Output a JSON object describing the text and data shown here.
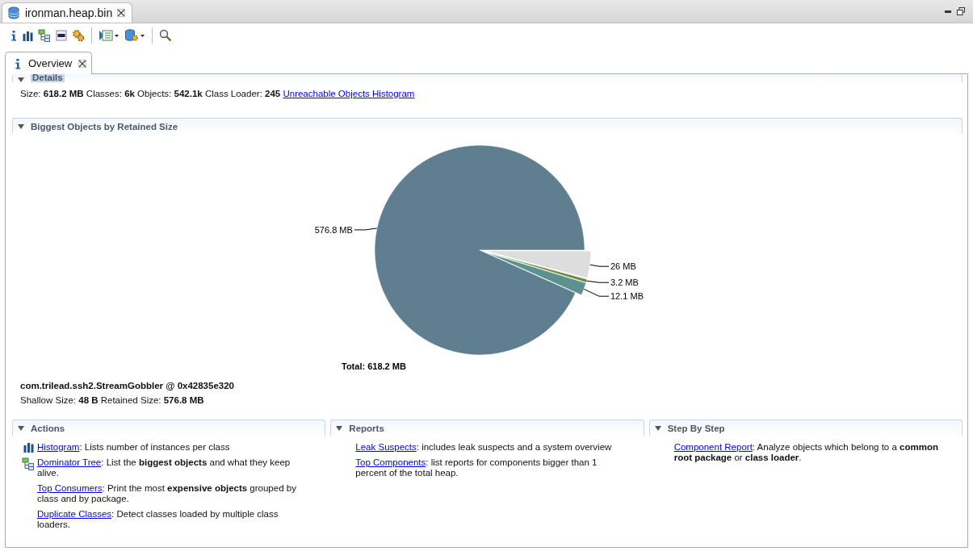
{
  "editor_tab": {
    "title": "ironman.heap.bin",
    "selected": true
  },
  "overview_tab": {
    "label": "Overview",
    "selected": true
  },
  "details": {
    "title": "Details",
    "expanded": true,
    "summary": "Size: **618.2 MB** Classes: **6k** Objects: **542.1k** Class Loader: **245**",
    "link": "Unreachable Objects Histogram"
  },
  "biggest_objects": {
    "title": "Biggest Objects by Retained Size",
    "expanded": true,
    "chart_data": {
      "type": "pie",
      "values": [
        26,
        3.2,
        12.1,
        576.8
      ],
      "value_labels": [
        "26 MB",
        "3.2 MB",
        "12.1 MB",
        "576.8 MB"
      ],
      "colors": [
        "#dddddd",
        "#6e8b3d",
        "#5f9090",
        "#5f7f90"
      ],
      "title": "Total: 618.2 MB"
    },
    "object": "com.trilead.ssh2.StreamGobbler @ 0x42835e320",
    "sizes": "Shallow Size: **48 B** Retained Size: **576.8 MB**"
  },
  "sections": [
    {
      "title": "Actions",
      "expanded": true,
      "items": [
        {
          "kind": "histogram",
          "link": "Histogram",
          "text": ": Lists number of instances per class"
        },
        {
          "kind": "tree",
          "link": "Dominator Tree",
          "text": ": List the **biggest objects** and what they keep alive."
        },
        {
          "kind": "plain",
          "link": "Top Consumers",
          "text": ": Print the most **expensive objects** grouped by class and by package."
        },
        {
          "kind": "plain",
          "link": "Duplicate Classes",
          "text": ": Detect classes loaded by multiple class loaders."
        }
      ]
    },
    {
      "title": "Reports",
      "expanded": true,
      "items": [
        {
          "kind": "plain",
          "link": "Leak Suspects",
          "text": ": includes leak suspects and a system overview"
        },
        {
          "kind": "plain",
          "link": "Top Components",
          "text": ": list reports for components bigger than 1 percent of the total heap."
        }
      ]
    },
    {
      "title": "Step By Step",
      "expanded": true,
      "items": [
        {
          "kind": "plain",
          "link": "Component Report",
          "text": ": Analyze objects which belong to a **common root package** or **class loader**."
        }
      ]
    }
  ]
}
